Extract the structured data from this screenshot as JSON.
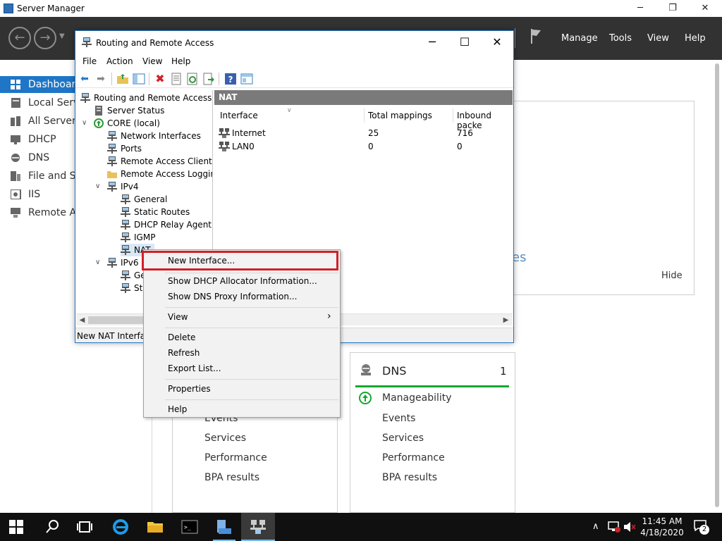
{
  "server_manager": {
    "title": "Server Manager",
    "menu": [
      "Manage",
      "Tools",
      "View",
      "Help"
    ],
    "sidebar": [
      {
        "label": "Dashboard"
      },
      {
        "label": "Local Serve"
      },
      {
        "label": "All Servers"
      },
      {
        "label": "DHCP"
      },
      {
        "label": "DNS"
      },
      {
        "label": "File and Sto"
      },
      {
        "label": "IIS"
      },
      {
        "label": "Remote Ac"
      }
    ],
    "main": {
      "ies_fragment": "es",
      "hide_label": "Hide",
      "left_tile": [
        "Events",
        "Services",
        "Performance",
        "BPA results"
      ],
      "dns_tile": {
        "title": "DNS",
        "count": "1",
        "rows": [
          "Manageability",
          "Events",
          "Services",
          "Performance",
          "BPA results"
        ]
      }
    }
  },
  "rras": {
    "title": "Routing and Remote Access",
    "menu": [
      "File",
      "Action",
      "View",
      "Help"
    ],
    "tree": [
      {
        "label": "Routing and Remote Access"
      },
      {
        "label": "Server Status"
      },
      {
        "label": "CORE (local)"
      },
      {
        "label": "Network Interfaces"
      },
      {
        "label": "Ports"
      },
      {
        "label": "Remote Access Clients (("
      },
      {
        "label": "Remote Access Logging"
      },
      {
        "label": "IPv4"
      },
      {
        "label": "General"
      },
      {
        "label": "Static Routes"
      },
      {
        "label": "DHCP Relay Agent"
      },
      {
        "label": "IGMP"
      },
      {
        "label": "NAT"
      },
      {
        "label": "IPv6"
      },
      {
        "label": "Ge"
      },
      {
        "label": "Sta"
      }
    ],
    "panel_title": "NAT",
    "columns": [
      "Interface",
      "Total mappings",
      "Inbound packe"
    ],
    "rows": [
      [
        "Internet",
        "25",
        "716"
      ],
      [
        "LAN0",
        "0",
        "0"
      ]
    ],
    "status": "New NAT Interfac"
  },
  "context_menu": {
    "items": [
      "New Interface...",
      "Show DHCP Allocator Information...",
      "Show DNS Proxy Information...",
      "View",
      "Delete",
      "Refresh",
      "Export List...",
      "Properties",
      "Help"
    ],
    "submenu_arrow": "›"
  },
  "taskbar": {
    "time": "11:45 AM",
    "date": "4/18/2020",
    "notification_count": "2"
  }
}
